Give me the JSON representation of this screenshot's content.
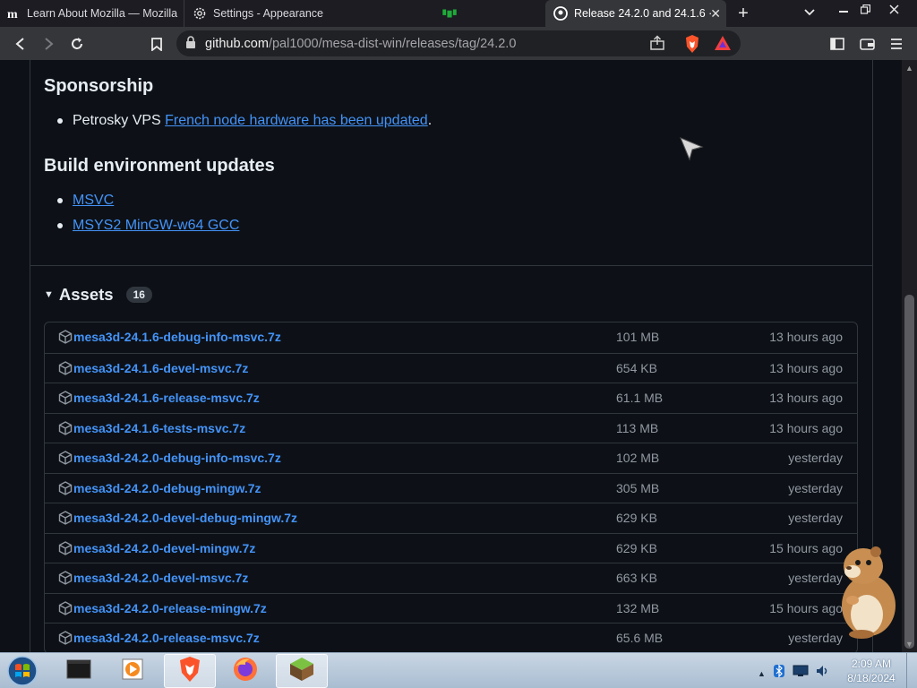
{
  "browser": {
    "tabs": [
      {
        "title": "Learn About Mozilla — Mozilla",
        "icon": "mozilla-m-icon"
      },
      {
        "title": "Settings - Appearance",
        "icon": "settings-gear-icon"
      },
      {
        "title": "",
        "icon": "puzzle-game-icon"
      },
      {
        "title": "Release 24.2.0 and 24.1.6 ·",
        "icon": "github-icon",
        "active": true
      }
    ],
    "new_tab": "+",
    "url_host": "github.com",
    "url_path": "/pal1000/mesa-dist-win/releases/tag/24.2.0"
  },
  "page": {
    "sponsorship_heading": "Sponsorship",
    "sponsorship_prefix": "Petrosky VPS ",
    "sponsorship_link": "French node hardware has been updated",
    "sponsorship_suffix": ".",
    "build_heading": "Build environment updates",
    "build_links": [
      "MSVC",
      "MSYS2 MinGW-w64 GCC"
    ],
    "assets_title": "Assets",
    "assets_count": "16",
    "assets": [
      {
        "name": "mesa3d-24.1.6-debug-info-msvc.7z",
        "size": "101 MB",
        "time": "13 hours ago"
      },
      {
        "name": "mesa3d-24.1.6-devel-msvc.7z",
        "size": "654 KB",
        "time": "13 hours ago"
      },
      {
        "name": "mesa3d-24.1.6-release-msvc.7z",
        "size": "61.1 MB",
        "time": "13 hours ago"
      },
      {
        "name": "mesa3d-24.1.6-tests-msvc.7z",
        "size": "113 MB",
        "time": "13 hours ago"
      },
      {
        "name": "mesa3d-24.2.0-debug-info-msvc.7z",
        "size": "102 MB",
        "time": "yesterday"
      },
      {
        "name": "mesa3d-24.2.0-debug-mingw.7z",
        "size": "305 MB",
        "time": "yesterday"
      },
      {
        "name": "mesa3d-24.2.0-devel-debug-mingw.7z",
        "size": "629 KB",
        "time": "yesterday"
      },
      {
        "name": "mesa3d-24.2.0-devel-mingw.7z",
        "size": "629 KB",
        "time": "15 hours ago"
      },
      {
        "name": "mesa3d-24.2.0-devel-msvc.7z",
        "size": "663 KB",
        "time": "yesterday"
      },
      {
        "name": "mesa3d-24.2.0-release-mingw.7z",
        "size": "132 MB",
        "time": "15 hours ago"
      },
      {
        "name": "mesa3d-24.2.0-release-msvc.7z",
        "size": "65.6 MB",
        "time": "yesterday"
      }
    ]
  },
  "taskbar": {
    "apps": [
      "terminal-icon",
      "media-player-icon",
      "brave-icon",
      "firefox-icon",
      "minecraft-icon"
    ],
    "time": "2:09 AM",
    "date": "8/18/2024"
  },
  "colors": {
    "page_bg": "#0d1117",
    "link": "#4493f8",
    "muted_text": "#9198a1",
    "border": "#30363d"
  }
}
